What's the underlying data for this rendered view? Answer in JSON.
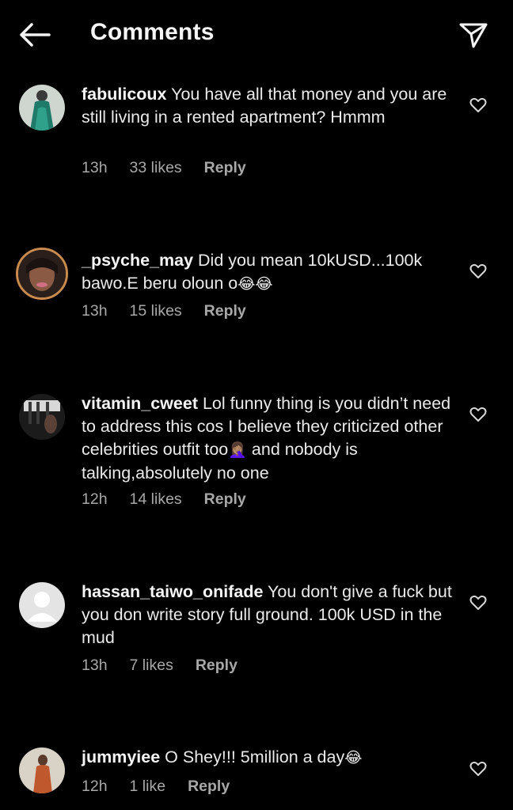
{
  "header": {
    "title": "Comments"
  },
  "comments": [
    {
      "username": "fabulicoux",
      "text": "You have all that money and you are still living in a rented apartment? Hmmm",
      "time": "13h",
      "likes": "33 likes",
      "reply": "Reply"
    },
    {
      "username": "_psyche_may",
      "text": "Did you mean 10kUSD...100k bawo.E beru oloun o",
      "emoji": "😂😂",
      "time": "13h",
      "likes": "15 likes",
      "reply": "Reply"
    },
    {
      "username": "vitamin_cweet",
      "text": "Lol funny thing is you didn’t need to address this cos I believe they criticized other celebrities outfit too",
      "emoji": "🤦🏽‍♀️",
      "text2": "and nobody is talking,absolutely no one",
      "time": "12h",
      "likes": "14 likes",
      "reply": "Reply"
    },
    {
      "username": "hassan_taiwo_onifade",
      "text": "You don't give a fuck but you don write story full ground. 100k USD in the mud",
      "time": "13h",
      "likes": "7 likes",
      "reply": "Reply"
    },
    {
      "username": "jummyiee",
      "text": "O Shey!!! 5million a day",
      "emoji": "😂",
      "time": "12h",
      "likes": "1 like",
      "reply": "Reply"
    }
  ]
}
